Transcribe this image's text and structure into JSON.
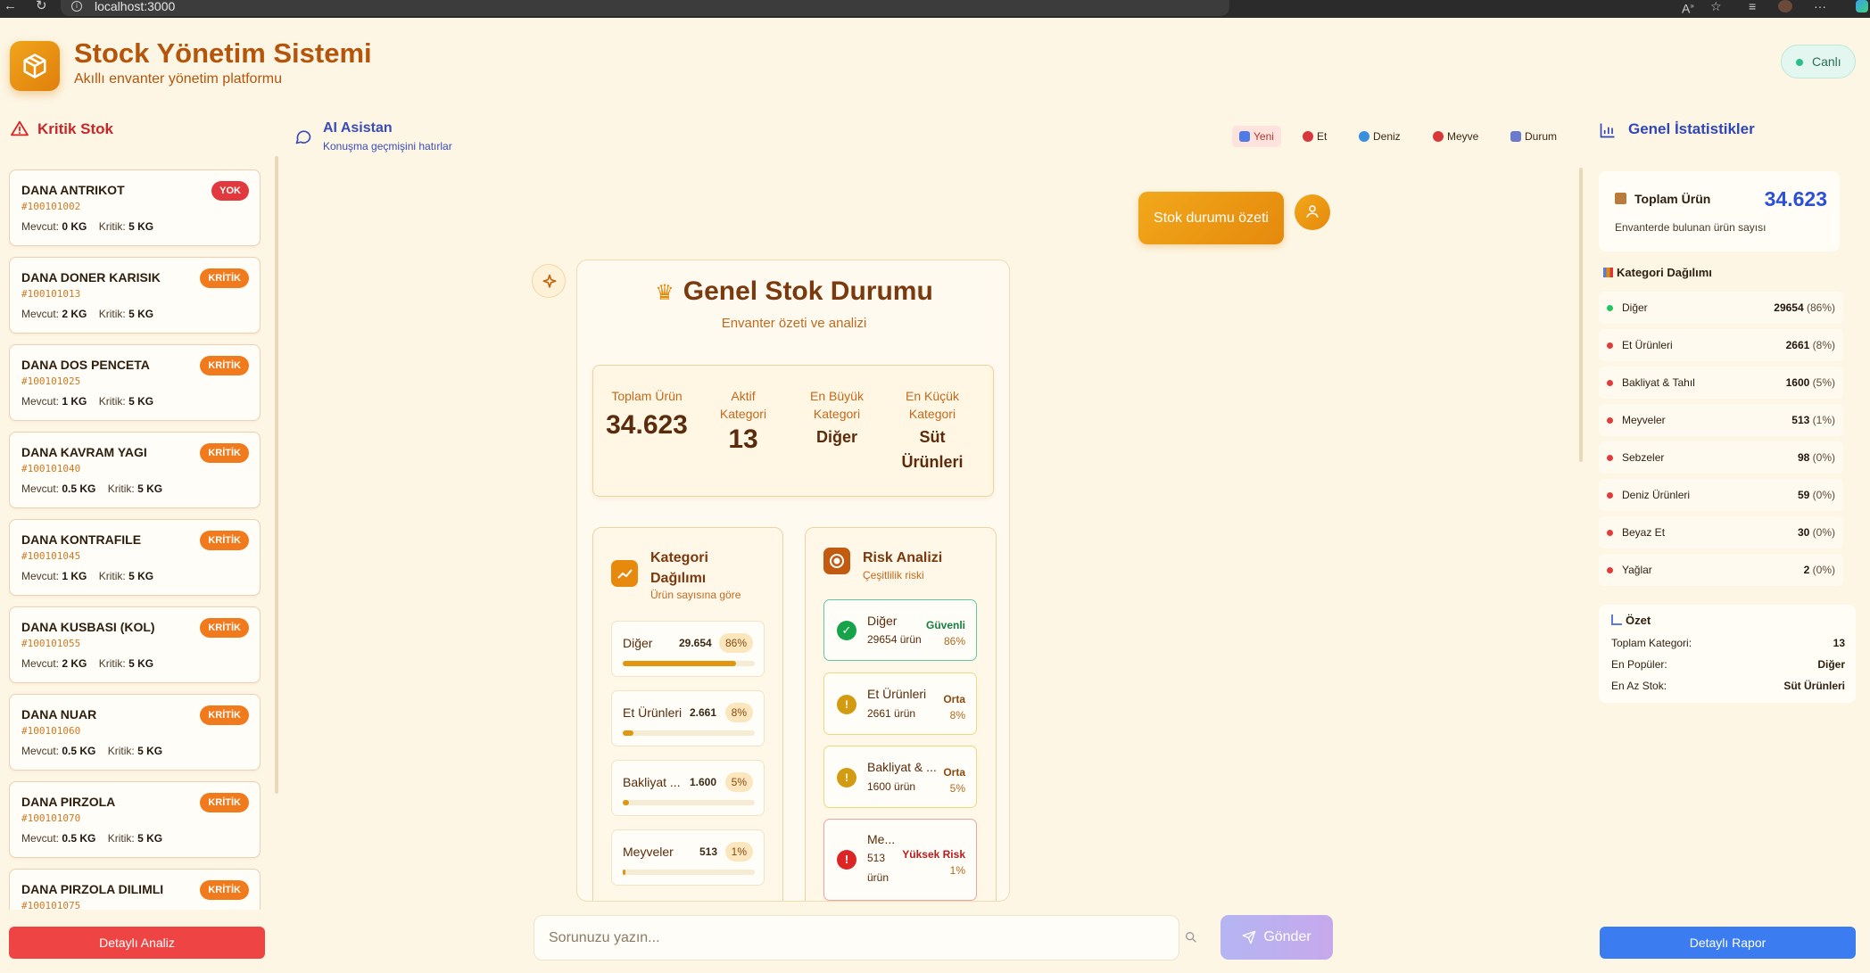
{
  "browser": {
    "url": "localhost:3000"
  },
  "app": {
    "title": "Stock Yönetim Sistemi",
    "subtitle": "Akıllı envanter yönetim platformu",
    "status": "Canlı"
  },
  "critical": {
    "title": "Kritik Stok",
    "items": [
      {
        "name": "DANA ANTRIKOT",
        "code": "#100101002",
        "badge": "YOK",
        "mevcut_label": "Mevcut:",
        "mevcut": "0 KG",
        "kritik_label": "Kritik:",
        "kritik": "5 KG"
      },
      {
        "name": "DANA DONER KARISIK",
        "code": "#100101013",
        "badge": "KRİTİK",
        "mevcut_label": "Mevcut:",
        "mevcut": "2 KG",
        "kritik_label": "Kritik:",
        "kritik": "5 KG"
      },
      {
        "name": "DANA DOS PENCETA",
        "code": "#100101025",
        "badge": "KRİTİK",
        "mevcut_label": "Mevcut:",
        "mevcut": "1 KG",
        "kritik_label": "Kritik:",
        "kritik": "5 KG"
      },
      {
        "name": "DANA KAVRAM YAGI",
        "code": "#100101040",
        "badge": "KRİTİK",
        "mevcut_label": "Mevcut:",
        "mevcut": "0.5 KG",
        "kritik_label": "Kritik:",
        "kritik": "5 KG"
      },
      {
        "name": "DANA KONTRAFILE",
        "code": "#100101045",
        "badge": "KRİTİK",
        "mevcut_label": "Mevcut:",
        "mevcut": "1 KG",
        "kritik_label": "Kritik:",
        "kritik": "5 KG"
      },
      {
        "name": "DANA KUSBASI (KOL)",
        "code": "#100101055",
        "badge": "KRİTİK",
        "mevcut_label": "Mevcut:",
        "mevcut": "2 KG",
        "kritik_label": "Kritik:",
        "kritik": "5 KG"
      },
      {
        "name": "DANA NUAR",
        "code": "#100101060",
        "badge": "KRİTİK",
        "mevcut_label": "Mevcut:",
        "mevcut": "0.5 KG",
        "kritik_label": "Kritik:",
        "kritik": "5 KG"
      },
      {
        "name": "DANA PIRZOLA",
        "code": "#100101070",
        "badge": "KRİTİK",
        "mevcut_label": "Mevcut:",
        "mevcut": "0.5 KG",
        "kritik_label": "Kritik:",
        "kritik": "5 KG"
      },
      {
        "name": "DANA PIRZOLA DILIMLI",
        "code": "#100101075",
        "badge": "KRİTİK",
        "mevcut_label": "",
        "mevcut": "",
        "kritik_label": "",
        "kritik": ""
      }
    ],
    "button": "Detaylı Analiz"
  },
  "assistant": {
    "title": "AI Asistan",
    "subtitle": "Konuşma geçmişini hatırlar",
    "quick_buttons": [
      {
        "label": "Yeni",
        "icon": "new-icon",
        "color": "#4f7be8"
      },
      {
        "label": "Et",
        "icon": "meat-icon",
        "color": "#d9383a"
      },
      {
        "label": "Deniz",
        "icon": "fish-icon",
        "color": "#3a8ee0"
      },
      {
        "label": "Meyve",
        "icon": "apple-icon",
        "color": "#d9383a"
      },
      {
        "label": "Durum",
        "icon": "chart-icon",
        "color": "#6a7ad0"
      }
    ],
    "user_message": "Stok durumu özeti",
    "input_placeholder": "Sorunuzu yazın...",
    "send": "Gönder"
  },
  "report": {
    "title": "Genel Stok Durumu",
    "subtitle": "Envanter özeti ve analizi",
    "summary": {
      "total_label": "Toplam Ürün",
      "total": "34.623",
      "active_label_1": "Aktif",
      "active_label_2": "Kategori",
      "active": "13",
      "largest_label_1": "En Büyük",
      "largest_label_2": "Kategori",
      "largest": "Diğer",
      "smallest_label_1": "En Küçük",
      "smallest_label_2": "Kategori",
      "smallest_1": "Süt",
      "smallest_2": "Ürünleri"
    },
    "category": {
      "title_1": "Kategori",
      "title_2": "Dağılımı",
      "subtitle": "Ürün sayısına göre",
      "rows": [
        {
          "name": "Diğer",
          "value": "29.654",
          "pct": "86%",
          "share": 0.86
        },
        {
          "name": "Et Ürünleri",
          "value": "2.661",
          "pct": "8%",
          "share": 0.08
        },
        {
          "name": "Bakliyat ...",
          "value": "1.600",
          "pct": "5%",
          "share": 0.05
        },
        {
          "name": "Meyveler",
          "value": "513",
          "pct": "1%",
          "share": 0.015
        }
      ]
    },
    "risk": {
      "title": "Risk Analizi",
      "subtitle": "Çeşitlilik riski",
      "rows": [
        {
          "name": "Diğer",
          "count": "29654 ürün",
          "level": "Güvenli",
          "pct": "86%",
          "kind": "safe"
        },
        {
          "name": "Et Ürünleri",
          "count": "2661 ürün",
          "level": "Orta",
          "pct": "8%",
          "kind": "mid"
        },
        {
          "name": "Bakliyat & ...",
          "count": "1600 ürün",
          "level": "Orta",
          "pct": "5%",
          "kind": "mid"
        },
        {
          "name": "Me...",
          "count_1": "513",
          "count_2": "ürün",
          "level": "Yüksek Risk",
          "pct": "1%",
          "kind": "high"
        }
      ]
    }
  },
  "stats": {
    "title": "Genel İstatistikler",
    "total_label": "Toplam Ürün",
    "total": "34.623",
    "total_desc": "Envanterde bulunan ürün sayısı",
    "category_title": "Kategori Dağılımı",
    "categories": [
      {
        "name": "Diğer",
        "value": "29654",
        "pct": "(86%)",
        "color": "#22c55e"
      },
      {
        "name": "Et Ürünleri",
        "value": "2661",
        "pct": "(8%)",
        "color": "#e23b3b"
      },
      {
        "name": "Bakliyat & Tahıl",
        "value": "1600",
        "pct": "(5%)",
        "color": "#e23b3b"
      },
      {
        "name": "Meyveler",
        "value": "513",
        "pct": "(1%)",
        "color": "#e23b3b"
      },
      {
        "name": "Sebzeler",
        "value": "98",
        "pct": "(0%)",
        "color": "#e23b3b"
      },
      {
        "name": "Deniz Ürünleri",
        "value": "59",
        "pct": "(0%)",
        "color": "#e23b3b"
      },
      {
        "name": "Beyaz Et",
        "value": "30",
        "pct": "(0%)",
        "color": "#e23b3b"
      },
      {
        "name": "Yağlar",
        "value": "2",
        "pct": "(0%)",
        "color": "#e23b3b"
      }
    ],
    "summary_title": "Özet",
    "summary_rows": [
      {
        "key": "Toplam Kategori:",
        "value": "13"
      },
      {
        "key": "En Popüler:",
        "value": "Diğer"
      },
      {
        "key": "En Az Stok:",
        "value": "Süt Ürünleri"
      }
    ],
    "button": "Detaylı Rapor"
  }
}
